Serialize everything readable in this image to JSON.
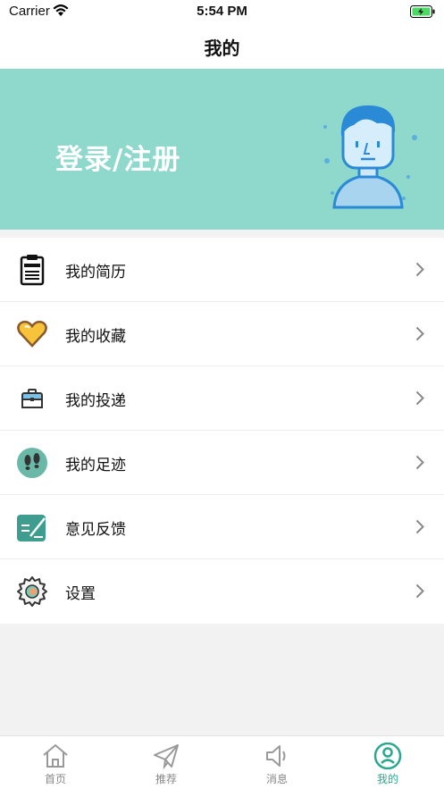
{
  "status_bar": {
    "carrier": "Carrier",
    "time": "5:54 PM"
  },
  "header": {
    "title": "我的"
  },
  "banner": {
    "login_label": "登录/注册",
    "color": "#8fd8cc"
  },
  "menu": {
    "items": [
      {
        "label": "我的简历",
        "icon": "resume-icon"
      },
      {
        "label": "我的收藏",
        "icon": "heart-icon"
      },
      {
        "label": "我的投递",
        "icon": "briefcase-icon"
      },
      {
        "label": "我的足迹",
        "icon": "footprints-icon"
      },
      {
        "label": "意见反馈",
        "icon": "feedback-icon"
      },
      {
        "label": "设置",
        "icon": "gear-icon"
      }
    ]
  },
  "tab_bar": {
    "tabs": [
      {
        "label": "首页",
        "icon": "home-icon"
      },
      {
        "label": "推荐",
        "icon": "paper-plane-icon"
      },
      {
        "label": "消息",
        "icon": "speaker-icon"
      },
      {
        "label": "我的",
        "icon": "profile-icon",
        "active": true
      }
    ],
    "active_color": "#2aa88f"
  }
}
